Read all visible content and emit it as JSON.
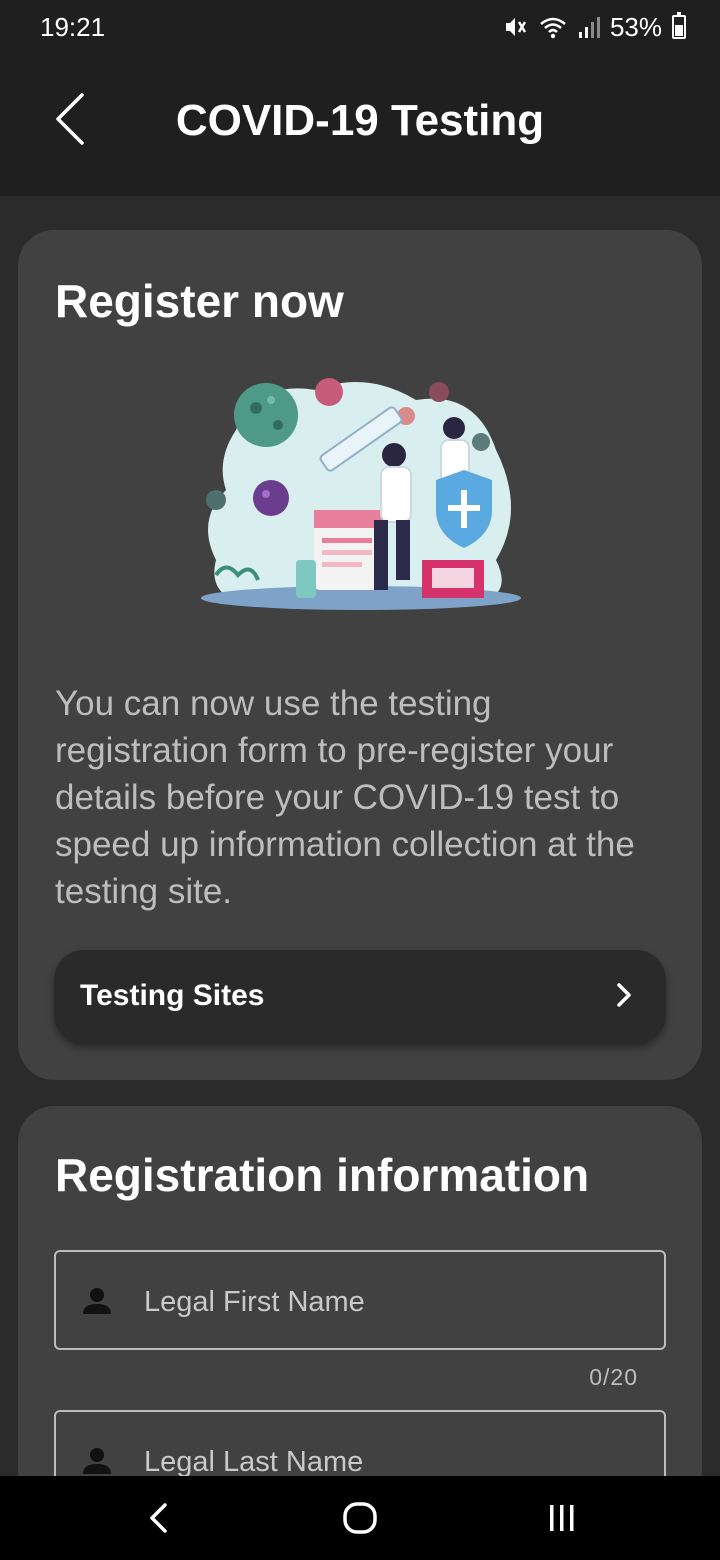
{
  "status_bar": {
    "time": "19:21",
    "battery_percent": "53%",
    "battery_level": 0.53,
    "icons": [
      "mute-icon",
      "wifi-icon",
      "signal-icon",
      "battery-icon"
    ]
  },
  "app_bar": {
    "title": "COVID-19 Testing",
    "back_icon": "chevron-left-icon"
  },
  "register_card": {
    "heading": "Register now",
    "illustration": "covid-testing-illustration",
    "description": "You can now use the testing registration form to pre-register your details before your COVID-19 test to speed up information collection at the testing site.",
    "testing_sites_label": "Testing Sites",
    "testing_sites_icon": "chevron-right-icon"
  },
  "registration_card": {
    "heading": "Registration information",
    "first_name": {
      "placeholder": "Legal First Name",
      "value": "",
      "counter": "0/20",
      "icon": "person-icon"
    },
    "last_name": {
      "placeholder": "Legal Last Name",
      "value": "",
      "icon": "person-icon"
    }
  },
  "nav_bar": {
    "icons": [
      "back-icon",
      "home-icon",
      "recent-apps-icon"
    ]
  },
  "colors": {
    "background": "#2b2b2b",
    "app_bar": "#1f1f1f",
    "card": "#414141",
    "button": "#2a2a2a",
    "text": "#ffffff",
    "muted_text": "#bdbdbd"
  }
}
